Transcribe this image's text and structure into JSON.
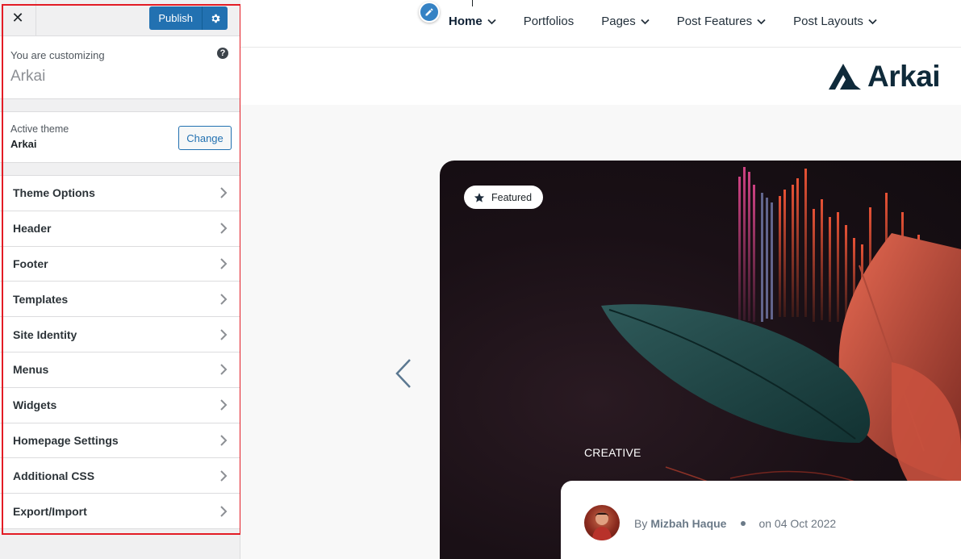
{
  "sidebar": {
    "close_label": "✕",
    "publish_label": "Publish",
    "customizing_label": "You are customizing",
    "customizing_theme": "Arkai",
    "help_label": "?",
    "active_theme_label": "Active theme",
    "active_theme_name": "Arkai",
    "change_label": "Change",
    "sections": [
      {
        "label": "Theme Options"
      },
      {
        "label": "Header"
      },
      {
        "label": "Footer"
      },
      {
        "label": "Templates"
      },
      {
        "label": "Site Identity"
      },
      {
        "label": "Menus"
      },
      {
        "label": "Widgets"
      },
      {
        "label": "Homepage Settings"
      },
      {
        "label": "Additional CSS"
      },
      {
        "label": "Export/Import"
      }
    ]
  },
  "preview": {
    "nav": [
      {
        "label": "Home",
        "has_dropdown": true,
        "active": true
      },
      {
        "label": "Portfolios",
        "has_dropdown": false
      },
      {
        "label": "Pages",
        "has_dropdown": true
      },
      {
        "label": "Post Features",
        "has_dropdown": true
      },
      {
        "label": "Post Layouts",
        "has_dropdown": true
      }
    ],
    "logo_text": "Arkai",
    "hero": {
      "badge": "Featured",
      "category": "CREATIVE",
      "by_label": "By",
      "author": "Mizbah Haque",
      "date": "on 04 Oct 2022"
    }
  },
  "colors": {
    "accent": "#2271b1",
    "highlight": "#e31c25",
    "logo": "#0f2a3a"
  }
}
